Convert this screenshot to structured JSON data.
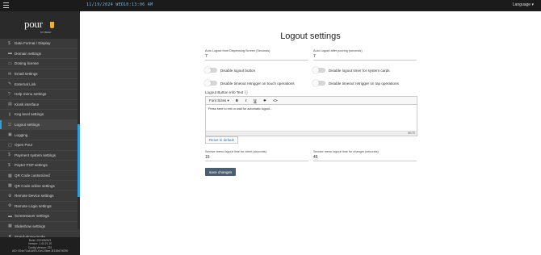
{
  "topbar": {
    "date": "11/19/2024 WED",
    "time": "10:13:06 AM",
    "language_label": "Language ▾"
  },
  "brand": {
    "logo": "pour",
    "logo_sub": "MY BEER"
  },
  "sidebar": {
    "items": [
      {
        "icon": "$",
        "label": "Data Format / Display"
      },
      {
        "icon": "▬",
        "label": "Domain settings"
      },
      {
        "icon": "▭",
        "label": "Dosing license"
      },
      {
        "icon": "✉",
        "label": "Email settings"
      },
      {
        "icon": "✎",
        "label": "External Link"
      },
      {
        "icon": "?",
        "label": "Help menu settings"
      },
      {
        "icon": "▤",
        "label": "Kiosk interface"
      },
      {
        "icon": "⚷",
        "label": "Keg level settings"
      },
      {
        "icon": "⎋",
        "label": "Logout settings"
      },
      {
        "icon": "▣",
        "label": "Logging"
      },
      {
        "icon": "▢",
        "label": "Open Pour"
      },
      {
        "icon": "$",
        "label": "Payment system settings"
      },
      {
        "icon": "$",
        "label": "Payter PSP settings"
      },
      {
        "icon": "▩",
        "label": "QR Code customized"
      },
      {
        "icon": "▩",
        "label": "QR Code online settings"
      },
      {
        "icon": "⚙",
        "label": "Remote Device settings"
      },
      {
        "icon": "⚙",
        "label": "Remote Login settings"
      },
      {
        "icon": "▬",
        "label": "Screensaver settings"
      },
      {
        "icon": "▦",
        "label": "Slideshow settings"
      },
      {
        "icon": "★",
        "label": "Stand-alone-mode"
      }
    ],
    "build_lines": [
      "Build: 20230509/3",
      "Version: 1.40.21.10",
      "Config Version: 232",
      "UID: 00de71a41d0f1-f1e4-96ee-3f138d74f290"
    ]
  },
  "page": {
    "title": "Logout settings",
    "auto_logout_dispensing_label": "Auto Logout from Dispensing Screen (Seconds)",
    "auto_logout_dispensing_value": "7",
    "auto_logout_pouring_label": "Auto Logout after pouring (seconds)",
    "auto_logout_pouring_value": "7",
    "toggle_disable_logout_button": "Disable logout button",
    "toggle_disable_timer_system_cards": "Disable logout timer for system cards",
    "toggle_disable_timeout_touch": "Disable timeout retrigger on touch operations",
    "toggle_disable_timeout_tap": "Disable timeout retrigger on tap operations",
    "editor_label": "Logout Button Info Text ⓘ",
    "editor_font_size": "Font Sizes ▾",
    "editor_bold": "B",
    "editor_italic": "I",
    "editor_underline": "U",
    "editor_strike": "T",
    "editor_code": "<>",
    "editor_text": "Press here to exit or wait for automatic logout...",
    "editor_counter": "50/70",
    "reset_button": "Reset to default",
    "service_client_label": "Service menu logout time for client (seconds)",
    "service_client_value": "15",
    "service_changer_label": "Service menu logout time for changer (seconds)",
    "service_changer_value": "45",
    "save_button": "save changes"
  }
}
